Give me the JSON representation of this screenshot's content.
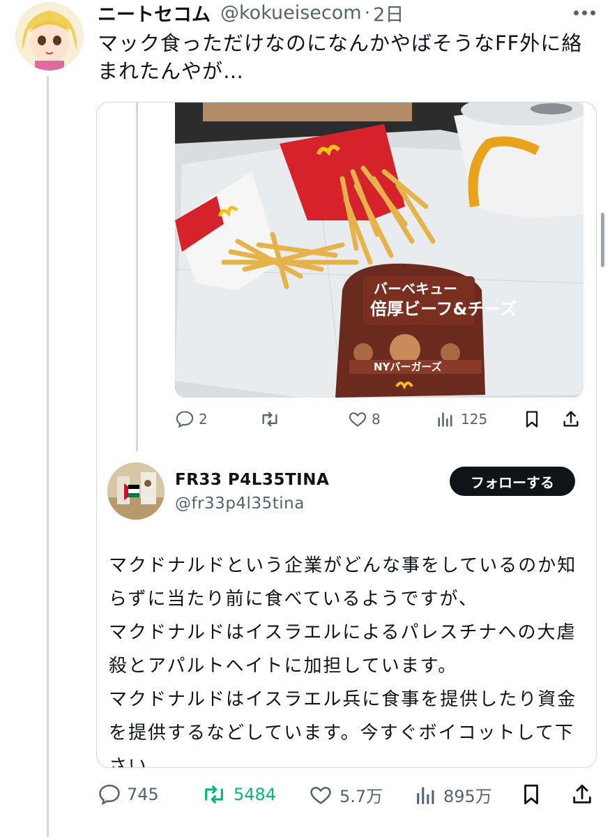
{
  "tweet": {
    "display_name": "ニートセコム",
    "handle": "@kokueisecom",
    "separator": "·",
    "time": "2日",
    "text": "マック食っただけなのになんかやばそうなFF外に絡まれたんやが…",
    "stats": {
      "replies": "745",
      "retweets": "5484",
      "likes": "5.7万",
      "views": "895万"
    },
    "retweet_color": "#00ba7c"
  },
  "quoted_tweet": {
    "stats": {
      "replies": "2",
      "retweets": "",
      "likes": "8",
      "views": "125"
    }
  },
  "reply": {
    "display_name": "FR33 P4L35TINA",
    "handle": "@fr33p4l35tina",
    "follow_label": "フォローする",
    "paragraphs": [
      "マクドナルドという企業がどんな事をしているのか知らずに当たり前に食べているようですが、",
      "マクドナルドはイスラエルによるパレスチナへの大虐殺とアパルトヘイトに加担しています。",
      "マクドナルドはイスラエル兵に食事を提供したり資金を提供するなどしています。今すぐボイコットして下さい。"
    ]
  },
  "icons": {
    "reply": "reply-icon",
    "retweet": "retweet-icon",
    "like": "heart-icon",
    "views": "views-icon",
    "bookmark": "bookmark-icon",
    "share": "share-icon",
    "more": "more-icon"
  },
  "colors": {
    "text": "#0f1419",
    "secondary": "#536471",
    "border": "#cfd9de",
    "follow_button": "#0f1419"
  }
}
